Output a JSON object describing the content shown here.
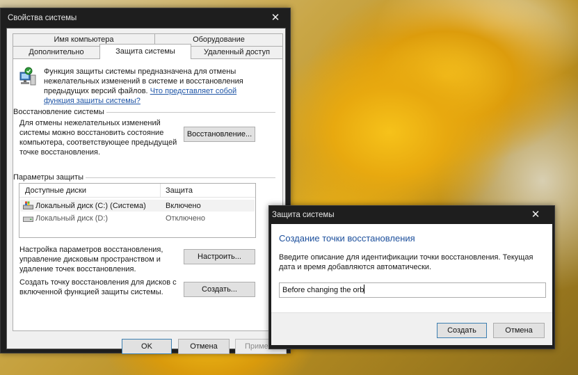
{
  "system_properties": {
    "title": "Свойства системы",
    "close_glyph": "✕",
    "tabs_top": [
      "Имя компьютера",
      "Оборудование"
    ],
    "tabs_bottom": [
      "Дополнительно",
      "Защита системы",
      "Удаленный доступ"
    ],
    "intro_text": "Функция защиты системы предназначена для отмены нежелательных изменений в системе и восстановления предыдущих версий файлов.",
    "intro_link": "Что представляет собой функция защиты системы?",
    "restore_group": {
      "title": "Восстановление системы",
      "description": "Для отмены нежелательных изменений системы можно восстановить состояние компьютера, соответствующее предыдущей точке восстановления.",
      "button": "Восстановление..."
    },
    "protection_group": {
      "title": "Параметры защиты",
      "columns": [
        "Доступные диски",
        "Защита"
      ],
      "drives": [
        {
          "name": "Локальный диск (C:) (Система)",
          "status": "Включено",
          "icon": "system-drive-icon"
        },
        {
          "name": "Локальный диск (D:)",
          "status": "Отключено",
          "icon": "drive-icon"
        }
      ],
      "configure_text": "Настройка параметров восстановления, управление дисковым пространством и удаление точек восстановления.",
      "configure_button": "Настроить...",
      "create_text": "Создать точку восстановления для дисков с включенной функцией защиты системы.",
      "create_button": "Создать..."
    },
    "footer": {
      "ok": "OK",
      "cancel": "Отмена",
      "apply": "Примени"
    }
  },
  "protect_dialog": {
    "title": "Защита системы",
    "close_glyph": "✕",
    "heading": "Создание точки восстановления",
    "description": "Введите описание для идентификации точки восстановления. Текущая дата и время добавляются автоматически.",
    "input_value": "Before changing the orb",
    "create_button": "Создать",
    "cancel_button": "Отмена"
  },
  "colors": {
    "heading_blue": "#1c4f9c",
    "link_blue": "#1f55a6",
    "titlebar_dark": "#1e1e1e"
  }
}
